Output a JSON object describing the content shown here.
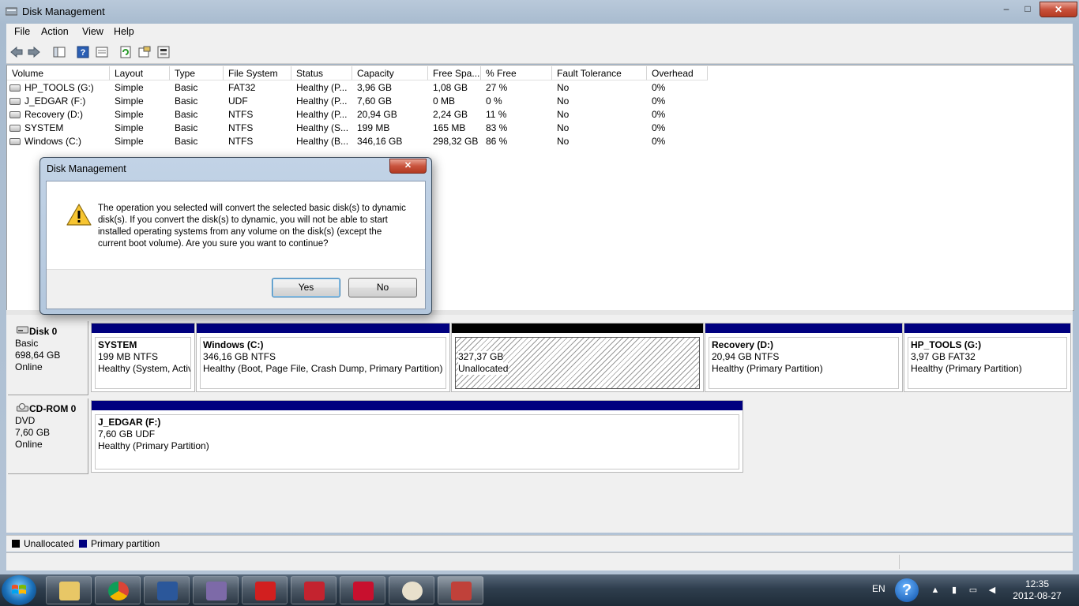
{
  "window": {
    "title": "Disk Management",
    "min": "–",
    "max": "□",
    "close": "✕"
  },
  "menu": [
    "File",
    "Action",
    "View",
    "Help"
  ],
  "toolbar": [
    "back-icon",
    "forward-icon",
    "console-tree-icon",
    "help-icon",
    "properties-icon",
    "refresh-icon",
    "settings-icon",
    "disk-props-icon"
  ],
  "volume_table": {
    "headers": [
      "Volume",
      "Layout",
      "Type",
      "File System",
      "Status",
      "Capacity",
      "Free Spa...",
      "% Free",
      "Fault Tolerance",
      "Overhead"
    ],
    "rows": [
      [
        "HP_TOOLS (G:)",
        "Simple",
        "Basic",
        "FAT32",
        "Healthy (P...",
        "3,96 GB",
        "1,08 GB",
        "27 %",
        "No",
        "0%"
      ],
      [
        "J_EDGAR (F:)",
        "Simple",
        "Basic",
        "UDF",
        "Healthy (P...",
        "7,60 GB",
        "0 MB",
        "0 %",
        "No",
        "0%"
      ],
      [
        "Recovery (D:)",
        "Simple",
        "Basic",
        "NTFS",
        "Healthy (P...",
        "20,94 GB",
        "2,24 GB",
        "11 %",
        "No",
        "0%"
      ],
      [
        "SYSTEM",
        "Simple",
        "Basic",
        "NTFS",
        "Healthy (S...",
        "199 MB",
        "165 MB",
        "83 %",
        "No",
        "0%"
      ],
      [
        "Windows (C:)",
        "Simple",
        "Basic",
        "NTFS",
        "Healthy (B...",
        "346,16 GB",
        "298,32 GB",
        "86 %",
        "No",
        "0%"
      ]
    ]
  },
  "disks": [
    {
      "name": "Disk 0",
      "type": "Basic",
      "size": "698,64 GB",
      "state": "Online",
      "partitions": [
        {
          "title": "SYSTEM",
          "size": "199 MB NTFS",
          "status": "Healthy (System, Activ"
        },
        {
          "title": "Windows  (C:)",
          "size": "346,16 GB NTFS",
          "status": "Healthy (Boot, Page File, Crash Dump, Primary Partition)"
        },
        {
          "title": "",
          "size": "327,37 GB",
          "status": "Unallocated"
        },
        {
          "title": "Recovery  (D:)",
          "size": "20,94 GB NTFS",
          "status": "Healthy (Primary Partition)"
        },
        {
          "title": "HP_TOOLS  (G:)",
          "size": "3,97 GB FAT32",
          "status": "Healthy (Primary Partition)"
        }
      ]
    },
    {
      "name": "CD-ROM 0",
      "type": "DVD",
      "size": "7,60 GB",
      "state": "Online",
      "partitions": [
        {
          "title": "J_EDGAR  (F:)",
          "size": "7,60 GB UDF",
          "status": "Healthy (Primary Partition)"
        }
      ]
    }
  ],
  "legend": {
    "unallocated": "Unallocated",
    "primary": "Primary partition",
    "unallocated_color": "#000000",
    "primary_color": "#00007f"
  },
  "dialog": {
    "title": "Disk Management",
    "message": "The operation you selected will convert the selected basic disk(s) to dynamic disk(s). If you convert the disk(s) to dynamic, you will not be able to start installed operating systems from any volume on the disk(s) (except the current boot volume). Are you sure you want to continue?",
    "yes": "Yes",
    "no": "No",
    "close": "✕",
    "icon": "warning-icon"
  },
  "taskbar": {
    "apps": [
      "explorer",
      "chrome",
      "word",
      "app4",
      "nt",
      "app6",
      "acrobat",
      "paint",
      "toolbox"
    ],
    "lang": "EN",
    "help": "?",
    "time": "12:35",
    "date": "2012-08-27"
  }
}
